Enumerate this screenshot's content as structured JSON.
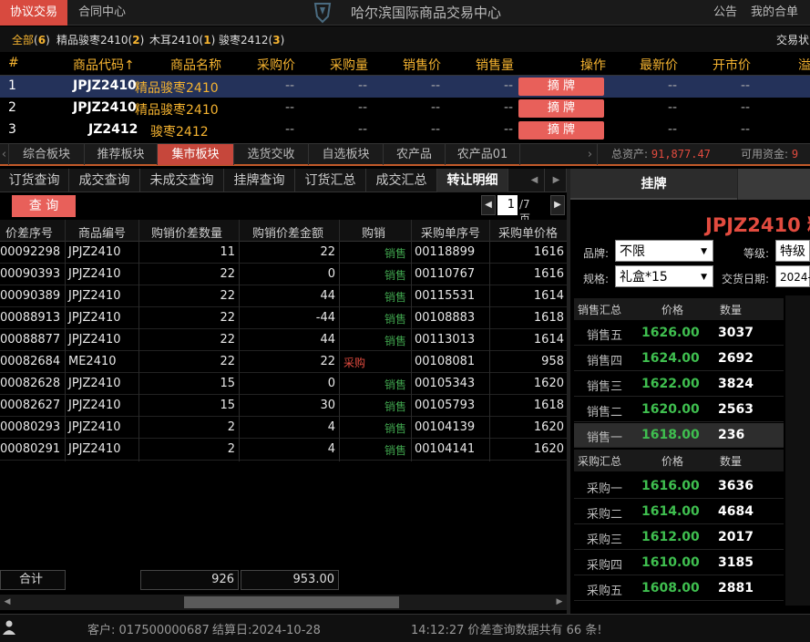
{
  "topbar": {
    "active_tab": "协议交易",
    "tab_contract": "合同中心",
    "title": "哈尔滨国际商品交易中心",
    "notice": "公告",
    "my_contract": "我的合单"
  },
  "filter": {
    "items": [
      {
        "label": "全部",
        "count": "6"
      },
      {
        "label": "精品骏枣2410",
        "count": "2"
      },
      {
        "label": "木耳2410",
        "count": "1"
      },
      {
        "label": "骏枣2412",
        "count": "3"
      }
    ],
    "right": "交易状"
  },
  "market": {
    "headers": [
      "#",
      "商品代码↑",
      "商品名称",
      "采购价",
      "采购量",
      "销售价",
      "销售量",
      "操作",
      "最新价",
      "开市价",
      "溢"
    ],
    "rows": [
      {
        "num": "1",
        "code": "JPJZ2410",
        "name": "精品骏枣2410",
        "d1": "--",
        "d2": "--",
        "d3": "--",
        "d4": "--",
        "op": "摘 牌",
        "d5": "--",
        "d6": "--"
      },
      {
        "num": "2",
        "code": "JPJZ2410",
        "name": "精品骏枣2410",
        "d1": "--",
        "d2": "--",
        "d3": "--",
        "d4": "--",
        "op": "摘 牌",
        "d5": "--",
        "d6": "--"
      },
      {
        "num": "3",
        "code": "JZ2412",
        "name": "骏枣2412",
        "d1": "--",
        "d2": "--",
        "d3": "--",
        "d4": "--",
        "op": "摘 牌",
        "d5": "--",
        "d6": "--"
      }
    ]
  },
  "sectors": {
    "tabs": [
      "综合板块",
      "推荐板块",
      "集市板块",
      "选货交收",
      "自选板块",
      "农产品",
      "农产品01"
    ],
    "active_index": 2,
    "total_assets_label": "总资产:",
    "total_assets": "91,877.47",
    "available_label": "可用资金:",
    "available": "9"
  },
  "left_tabs": [
    "订货查询",
    "成交查询",
    "未成交查询",
    "挂牌查询",
    "订货汇总",
    "成交汇总",
    "转让明细"
  ],
  "query_button": "查 询",
  "pager": {
    "current": "1",
    "total": "/7页",
    "prev": "◀",
    "next": "▶"
  },
  "grid": {
    "headers": [
      "价差序号",
      "商品编号",
      "购销价差数量",
      "购销价差金额",
      "购销",
      "采购单序号",
      "采购单价格"
    ],
    "rows": [
      [
        "00092298",
        "JPJZ2410",
        "11",
        "22",
        "销售",
        "00118899",
        "1616"
      ],
      [
        "00090393",
        "JPJZ2410",
        "22",
        "0",
        "销售",
        "00110767",
        "1616"
      ],
      [
        "00090389",
        "JPJZ2410",
        "22",
        "44",
        "销售",
        "00115531",
        "1614"
      ],
      [
        "00088913",
        "JPJZ2410",
        "22",
        "-44",
        "销售",
        "00108883",
        "1618"
      ],
      [
        "00088877",
        "JPJZ2410",
        "22",
        "44",
        "销售",
        "00113013",
        "1614"
      ],
      [
        "00082684",
        "ME2410",
        "22",
        "22",
        "采购",
        "00108081",
        "958"
      ],
      [
        "00082628",
        "JPJZ2410",
        "15",
        "0",
        "销售",
        "00105343",
        "1620"
      ],
      [
        "00082627",
        "JPJZ2410",
        "15",
        "30",
        "销售",
        "00105793",
        "1618"
      ],
      [
        "00080293",
        "JPJZ2410",
        "2",
        "4",
        "销售",
        "00104139",
        "1620"
      ],
      [
        "00080291",
        "JPJZ2410",
        "2",
        "4",
        "销售",
        "00104141",
        "1620"
      ]
    ],
    "sum_label": "合计",
    "sum_qty": "926",
    "sum_amount": "953.00"
  },
  "status": {
    "customer": "客户: 017500000687",
    "settle_date": "结算日:2024-10-28",
    "message": "14:12:27 价差查询数据共有 66 条!"
  },
  "right": {
    "tab": "挂牌",
    "code": "JPJZ2410 精",
    "brand_label": "品牌:",
    "brand_value": "不限",
    "grade_label": "等级:",
    "grade_value": "特级",
    "spec_label": "规格:",
    "spec_value": "礼盒*15",
    "date_label": "交货日期:",
    "date_value": "2024-",
    "sell_head": [
      "销售汇总",
      "价格",
      "数量"
    ],
    "sells": [
      {
        "label": "销售五",
        "price": "1626.00",
        "qty": "3037"
      },
      {
        "label": "销售四",
        "price": "1624.00",
        "qty": "2692"
      },
      {
        "label": "销售三",
        "price": "1622.00",
        "qty": "3824"
      },
      {
        "label": "销售二",
        "price": "1620.00",
        "qty": "2563"
      },
      {
        "label": "销售一",
        "price": "1618.00",
        "qty": "236"
      }
    ],
    "buy_head": [
      "采购汇总",
      "价格",
      "数量"
    ],
    "buys": [
      {
        "label": "采购一",
        "price": "1616.00",
        "qty": "3636"
      },
      {
        "label": "采购二",
        "price": "1614.00",
        "qty": "4684"
      },
      {
        "label": "采购三",
        "price": "1612.00",
        "qty": "2017"
      },
      {
        "label": "采购四",
        "price": "1610.00",
        "qty": "3185"
      },
      {
        "label": "采购五",
        "price": "1608.00",
        "qty": "2881"
      }
    ]
  },
  "colors": {
    "accent": "#d84a3f",
    "sell_green": "#3fa34d",
    "buy_red": "#e24b3f",
    "gold": "#f5b330"
  }
}
